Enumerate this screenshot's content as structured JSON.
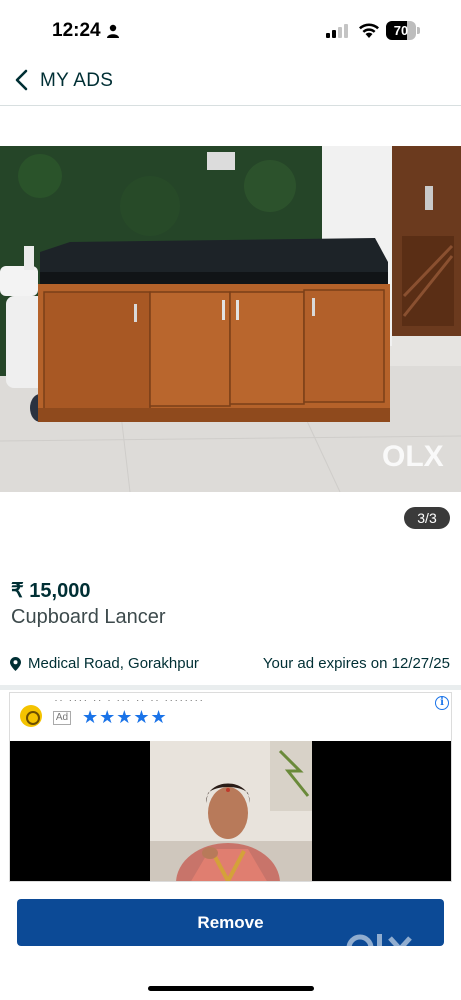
{
  "status_bar": {
    "time": "12:24",
    "battery": "70",
    "battery_level": 0.7,
    "icons": [
      "person-icon",
      "signal-icon",
      "wifi-icon",
      "battery-icon"
    ]
  },
  "header": {
    "back_icon": "chevron-left-icon",
    "title": "MY ADS"
  },
  "gallery": {
    "image_description": "Brown wooden cabinet with black cushioned top",
    "watermark": "OLX",
    "counter": "3/3"
  },
  "ad": {
    "price": "₹ 15,000",
    "title": "Cupboard Lancer",
    "location": "Medical Road, Gorakhpur",
    "expiry": "Your ad expires on 12/27/25"
  },
  "sponsored": {
    "label": "Ad",
    "stars": "★★★★★",
    "rating": 4.5,
    "info_icon": "i"
  },
  "actions": {
    "remove_label": "Remove"
  },
  "colors": {
    "primary": "#0c4a96",
    "text": "#002f34",
    "star": "#1a73e8"
  }
}
